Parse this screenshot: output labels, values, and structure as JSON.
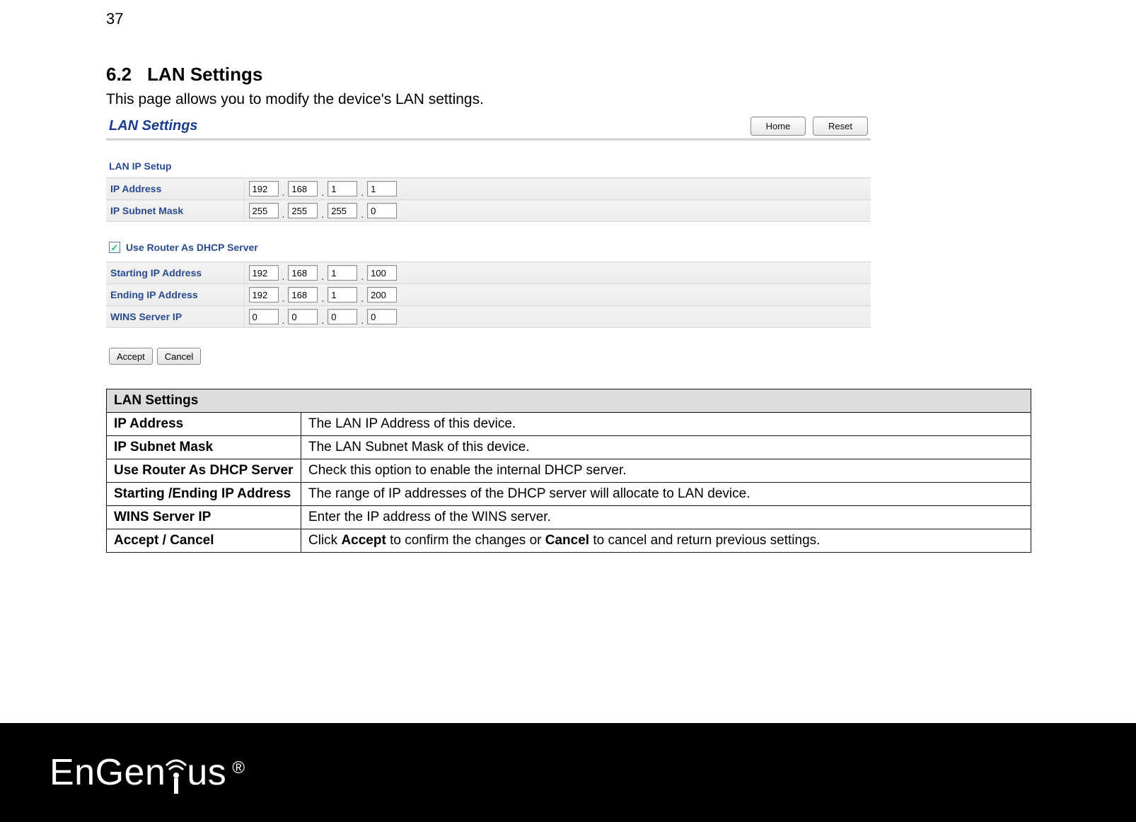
{
  "page_number": "37",
  "heading": {
    "number": "6.2",
    "title": "LAN Settings"
  },
  "intro": "This page allows you to modify the device's LAN settings.",
  "screenshot": {
    "title": "LAN Settings",
    "buttons": {
      "home": "Home",
      "reset": "Reset"
    },
    "lan_ip_setup_label": "LAN IP Setup",
    "rows": {
      "ip_address": {
        "label": "IP Address",
        "octets": [
          "192",
          "168",
          "1",
          "1"
        ]
      },
      "ip_subnet": {
        "label": "IP Subnet Mask",
        "octets": [
          "255",
          "255",
          "255",
          "0"
        ]
      }
    },
    "dhcp_checkbox": {
      "checked": true,
      "label": "Use Router As DHCP Server"
    },
    "dhcp_rows": {
      "starting": {
        "label": "Starting IP Address",
        "octets": [
          "192",
          "168",
          "1",
          "100"
        ]
      },
      "ending": {
        "label": "Ending IP Address",
        "octets": [
          "192",
          "168",
          "1",
          "200"
        ]
      },
      "wins": {
        "label": "WINS Server IP",
        "octets": [
          "0",
          "0",
          "0",
          "0"
        ]
      }
    },
    "actions": {
      "accept": "Accept",
      "cancel": "Cancel"
    }
  },
  "desc": {
    "header": "LAN Settings",
    "rows": [
      {
        "key": "IP Address",
        "val": "The LAN IP Address of this device."
      },
      {
        "key": "IP Subnet Mask",
        "val": "The LAN Subnet Mask of this device."
      },
      {
        "key": "Use Router As DHCP Server",
        "val": "Check this option to enable the internal DHCP server."
      },
      {
        "key": "Starting /Ending IP Address",
        "val": "The range of IP addresses of the DHCP server will allocate to LAN device."
      },
      {
        "key": "WINS Server IP",
        "val": "Enter the IP address of the WINS server."
      },
      {
        "key": "Accept / Cancel",
        "val": "Click <b>Accept</b> to confirm the changes or <b>Cancel</b> to cancel and return previous settings."
      }
    ]
  },
  "brand": "EnGenius"
}
